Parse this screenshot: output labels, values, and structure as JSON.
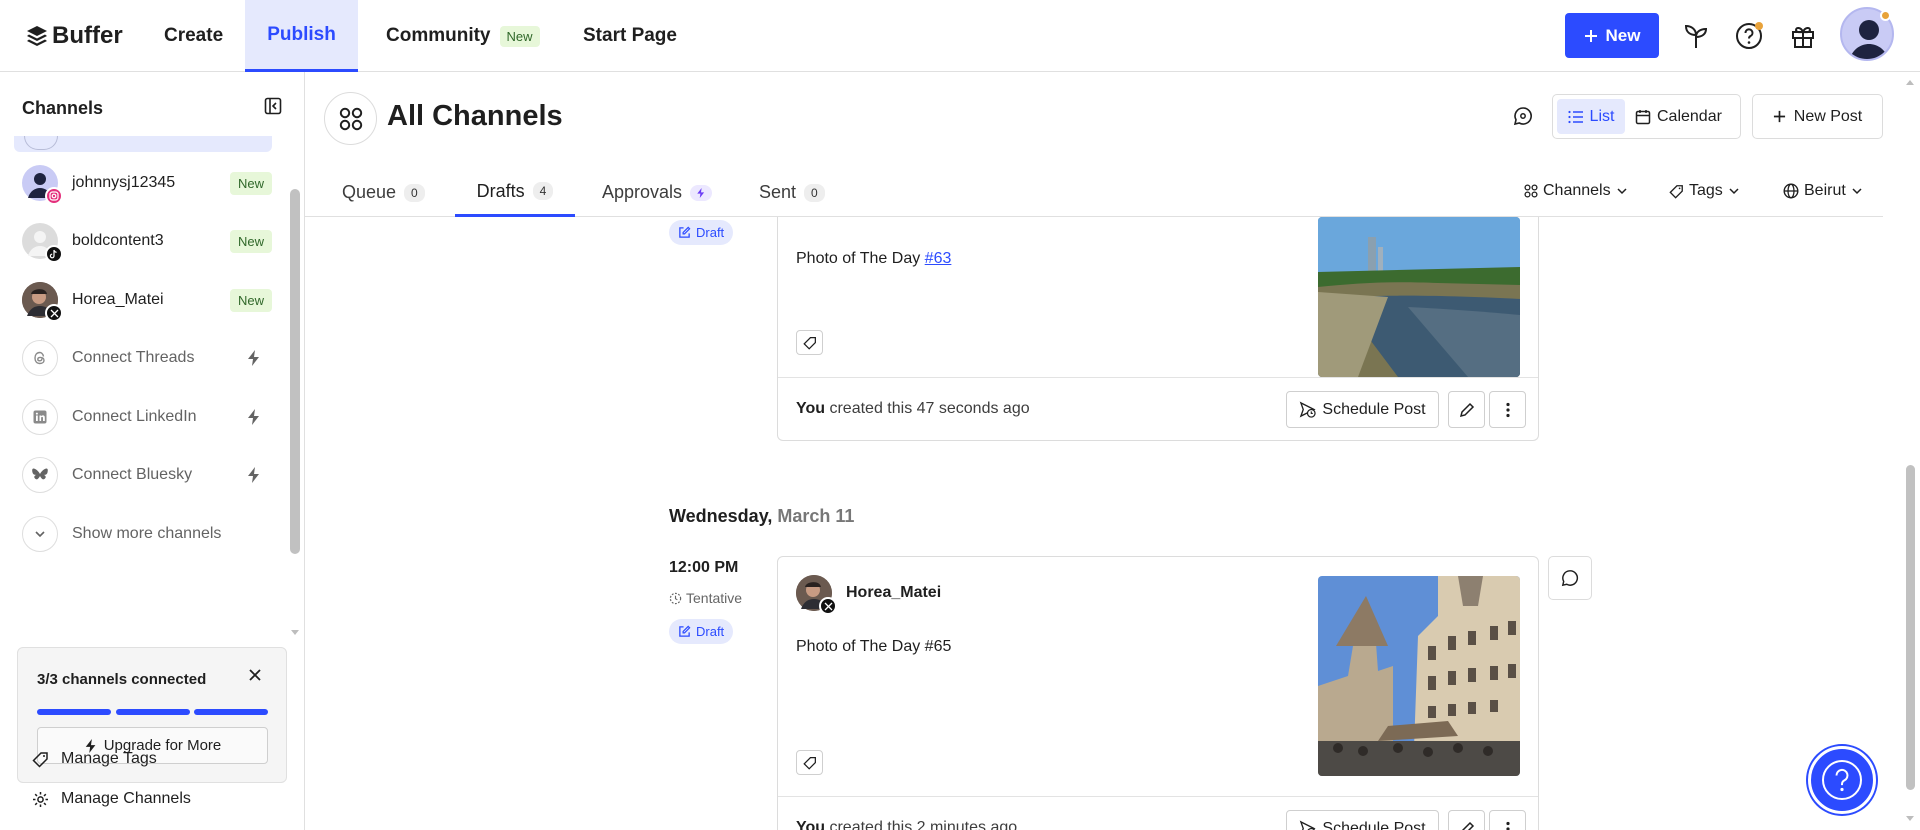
{
  "app": {
    "name": "Buffer"
  },
  "nav": {
    "create": "Create",
    "publish": "Publish",
    "community": "Community",
    "community_badge": "New",
    "start_page": "Start Page",
    "new_button": "New"
  },
  "sidebar": {
    "title": "Channels",
    "channels": [
      {
        "name": "johnnysj12345",
        "badge": "New",
        "network": "instagram"
      },
      {
        "name": "boldcontent3",
        "badge": "New",
        "network": "tiktok"
      },
      {
        "name": "Horea_Matei",
        "badge": "New",
        "network": "x"
      }
    ],
    "connect": [
      {
        "label": "Connect Threads",
        "icon": "threads-icon"
      },
      {
        "label": "Connect LinkedIn",
        "icon": "linkedin-icon"
      },
      {
        "label": "Connect Bluesky",
        "icon": "bluesky-icon"
      }
    ],
    "show_more": "Show more channels",
    "connected_card": {
      "title": "3/3 channels connected",
      "upgrade_label": "Upgrade for More",
      "progress": [
        1,
        1,
        1
      ]
    },
    "manage_tags": "Manage Tags",
    "manage_channels": "Manage Channels"
  },
  "main": {
    "title": "All Channels",
    "view": {
      "list": "List",
      "calendar": "Calendar"
    },
    "new_post": "New Post",
    "tabs": [
      {
        "label": "Queue",
        "count": "0"
      },
      {
        "label": "Drafts",
        "count": "4"
      },
      {
        "label": "Approvals",
        "count": ""
      },
      {
        "label": "Sent",
        "count": "0"
      }
    ],
    "filters": {
      "channels": "Channels",
      "tags": "Tags",
      "timezone": "Beirut"
    }
  },
  "posts": [
    {
      "status": "Draft",
      "text_prefix": "Photo of The Day ",
      "text_link": "#63",
      "footer_you": "You",
      "footer_rest": " created this 47 seconds ago",
      "schedule_label": "Schedule Post"
    },
    {
      "date_weekday": "Wednesday,",
      "date_day": "March 11",
      "time": "12:00 PM",
      "tentative": "Tentative",
      "status": "Draft",
      "author": "Horea_Matei",
      "text": "Photo of The Day #65",
      "footer_you": "You",
      "footer_rest": " created this 2 minutes ago",
      "schedule_label": "Schedule Post"
    }
  ],
  "colors": {
    "accent": "#2c4bff",
    "badge_bg": "#e7f7d9",
    "badge_text": "#30682a"
  }
}
